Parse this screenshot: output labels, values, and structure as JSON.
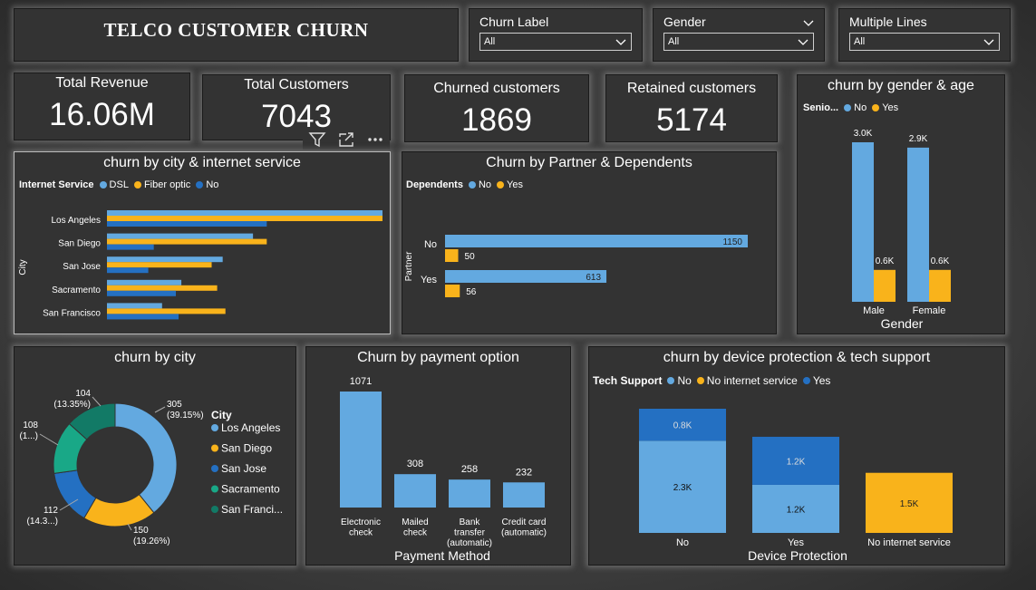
{
  "header": {
    "title": "TELCO CUSTOMER CHURN"
  },
  "slicers": [
    {
      "label": "Churn Label",
      "value": "All"
    },
    {
      "label": "Gender",
      "value": "All"
    },
    {
      "label": "Multiple Lines",
      "value": "All"
    }
  ],
  "kpis": [
    {
      "label": "Total Revenue",
      "value": "16.06M"
    },
    {
      "label": "Total Customers",
      "value": "7043"
    },
    {
      "label": "Churned customers",
      "value": "1869"
    },
    {
      "label": "Retained customers",
      "value": "5174"
    }
  ],
  "colors": {
    "light_blue": "#63a9e0",
    "yellow": "#f9b31b",
    "dark_blue": "#2470c2",
    "teal": "#19a887",
    "dark_teal": "#127a66"
  },
  "city_internet": {
    "title": "churn by city & internet service",
    "legend_title": "Internet Service",
    "legend": [
      "DSL",
      "Fiber optic",
      "No"
    ],
    "ylabel": "City",
    "cities": [
      "Los Angeles",
      "San Diego",
      "San Jose",
      "Sacramento",
      "San Francisco"
    ],
    "series": [
      {
        "name": "DSL",
        "values": [
          100,
          53,
          42,
          27,
          20
        ]
      },
      {
        "name": "Fiber optic",
        "values": [
          100,
          58,
          38,
          40,
          43
        ]
      },
      {
        "name": "No",
        "values": [
          58,
          17,
          15,
          25,
          26
        ]
      }
    ]
  },
  "partner": {
    "title": "Churn by Partner & Dependents",
    "legend_title": "Dependents",
    "legend": [
      "No",
      "Yes"
    ],
    "ylabel": "Partner",
    "categories": [
      "No",
      "Yes"
    ],
    "series": [
      {
        "name": "No",
        "values": [
          1150,
          613
        ]
      },
      {
        "name": "Yes",
        "values": [
          50,
          56
        ]
      }
    ]
  },
  "gender_age": {
    "title": "churn by gender & age",
    "legend_title": "Senio...",
    "legend": [
      "No",
      "Yes"
    ],
    "xlabel": "Gender",
    "categories": [
      "Male",
      "Female"
    ],
    "series": [
      {
        "name": "No",
        "values": [
          3.0,
          2.9
        ],
        "labels": [
          "3.0K",
          "2.9K"
        ]
      },
      {
        "name": "Yes",
        "values": [
          0.6,
          0.6
        ],
        "labels": [
          "0.6K",
          "0.6K"
        ]
      }
    ]
  },
  "churn_city": {
    "title": "churn by city",
    "legend_title": "City",
    "legend": [
      "Los Angeles",
      "San Diego",
      "San Jose",
      "Sacramento",
      "San Franci..."
    ],
    "values": [
      305,
      150,
      112,
      108,
      104
    ],
    "labels": [
      [
        "305",
        "(39.15%)"
      ],
      [
        "150",
        "(19.26%)"
      ],
      [
        "112",
        "(14.3...)"
      ],
      [
        "108",
        "(1...)"
      ],
      [
        "104",
        "(13.35%)"
      ]
    ]
  },
  "payment": {
    "title": "Churn by payment option",
    "xlabel": "Payment Method",
    "categories": [
      [
        "Electronic",
        "check"
      ],
      [
        "Mailed",
        "check"
      ],
      [
        "Bank",
        "transfer",
        "(automatic)"
      ],
      [
        "Credit card",
        "(automatic)"
      ]
    ],
    "values": [
      1071,
      308,
      258,
      232
    ],
    "labels": [
      "1071",
      "308",
      "258",
      "232"
    ]
  },
  "device": {
    "title": "churn by device protection & tech support",
    "legend_title": "Tech Support",
    "legend": [
      "No",
      "No internet service",
      "Yes"
    ],
    "xlabel": "Device Protection",
    "categories": [
      "No",
      "Yes",
      "No internet service"
    ],
    "series": [
      {
        "name": "No",
        "values": [
          2.3,
          1.2,
          0
        ],
        "labels": [
          "2.3K",
          "1.2K",
          ""
        ]
      },
      {
        "name": "No internet service",
        "values": [
          0,
          0,
          1.5
        ],
        "labels": [
          "",
          "",
          "1.5K"
        ]
      },
      {
        "name": "Yes",
        "values": [
          0.8,
          1.2,
          0
        ],
        "labels": [
          "0.8K",
          "1.2K",
          ""
        ]
      }
    ]
  }
}
